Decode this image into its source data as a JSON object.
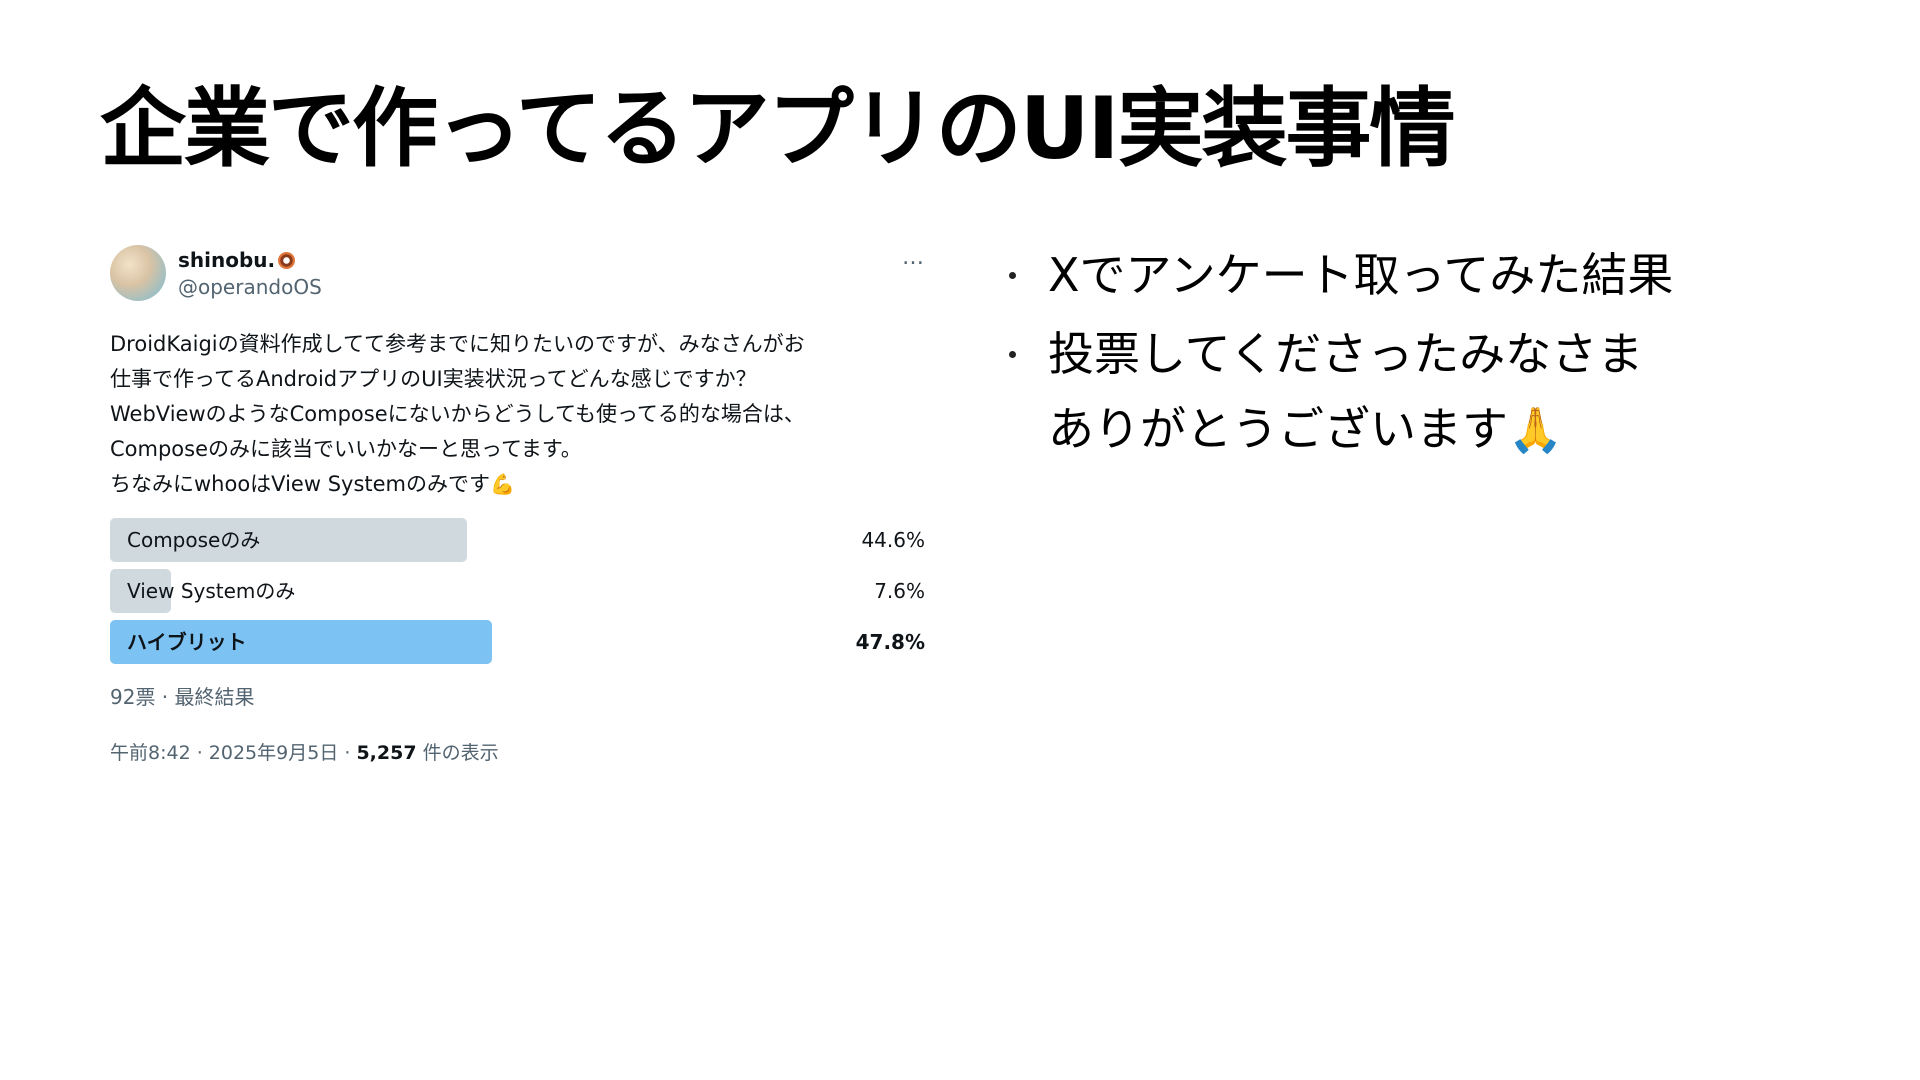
{
  "slide": {
    "title": "企業で作ってるアプリのUI実装事情"
  },
  "tweet": {
    "user_name": "shinobu.",
    "user_name_icon": "donut-icon",
    "handle": "@operandoOS",
    "more_icon": "…",
    "body_lines": [
      "DroidKaigiの資料作成してて参考までに知りたいのですが、みなさんがお",
      "仕事で作ってるAndroidアプリのUI実装状況ってどんな感じですか？",
      "WebViewのようなComposeにないからどうしても使ってる的な場合は、",
      "Composeのみに該当でいいかなーと思ってます。",
      "ちなみにwhooはView Systemのみです"
    ],
    "body_end_emoji": "💪",
    "poll": {
      "options": [
        {
          "label": "Composeのみ",
          "percent_text": "44.6%",
          "percent": 44.6,
          "winner": false
        },
        {
          "label": "View Systemのみ",
          "percent_text": "7.6%",
          "percent": 7.6,
          "winner": false
        },
        {
          "label": "ハイブリット",
          "percent_text": "47.8%",
          "percent": 47.8,
          "winner": true
        }
      ],
      "meta": "92票 · 最終結果"
    },
    "meta": {
      "time_date": "午前8:42 · 2025年9月5日 · ",
      "views_count": "5,257",
      "views_label": " 件の表示"
    }
  },
  "bullets": [
    {
      "lines": [
        "Xでアンケート取ってみた結果"
      ]
    },
    {
      "lines": [
        "投票してくださったみなさま",
        "ありがとうございます"
      ],
      "end_emoji": "🙏"
    }
  ],
  "colors": {
    "poll_bar": "#cfd9de",
    "poll_bar_winner": "#7cc2f3",
    "secondary_text": "#536471"
  }
}
